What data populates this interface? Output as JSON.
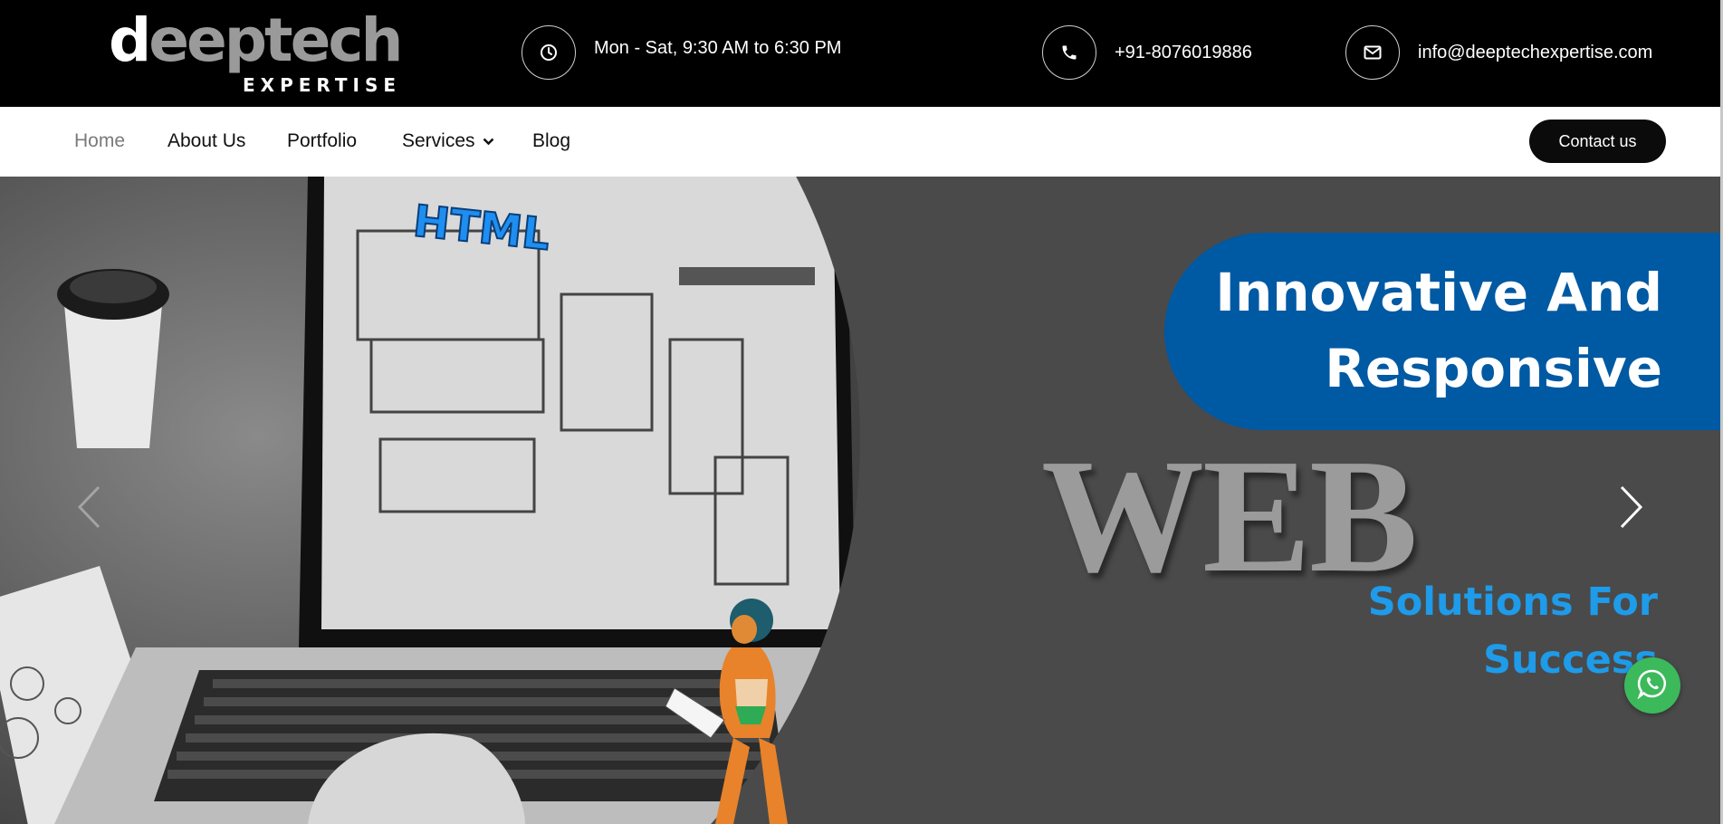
{
  "brand": {
    "logo_main_white": "d",
    "logo_main_grey": "eeptech",
    "logo_sub": "EXPERTISE"
  },
  "topbar": {
    "hours": {
      "icon": "clock-icon",
      "text": "Mon - Sat, 9:30 AM to 6:30 PM"
    },
    "phone": {
      "icon": "phone-icon",
      "text": "+91-8076019886"
    },
    "email": {
      "icon": "envelope-icon",
      "text": "info@deeptechexpertise.com"
    }
  },
  "nav": {
    "items": [
      {
        "label": "Home",
        "active": true
      },
      {
        "label": "About Us"
      },
      {
        "label": "Portfolio"
      },
      {
        "label": "Services",
        "has_dropdown": true
      },
      {
        "label": "Blog"
      }
    ],
    "contact_label": "Contact us"
  },
  "hero": {
    "banner_line1": "Innovative And",
    "banner_line2": "Responsive",
    "big_word": "WEB",
    "sub_line1": "Solutions For",
    "sub_line2": "Success"
  },
  "colors": {
    "banner_blue": "#0059a3",
    "accent_blue": "#1e9be9",
    "whatsapp_green": "#3cb95b",
    "hero_bg": "#4a4a4a"
  }
}
